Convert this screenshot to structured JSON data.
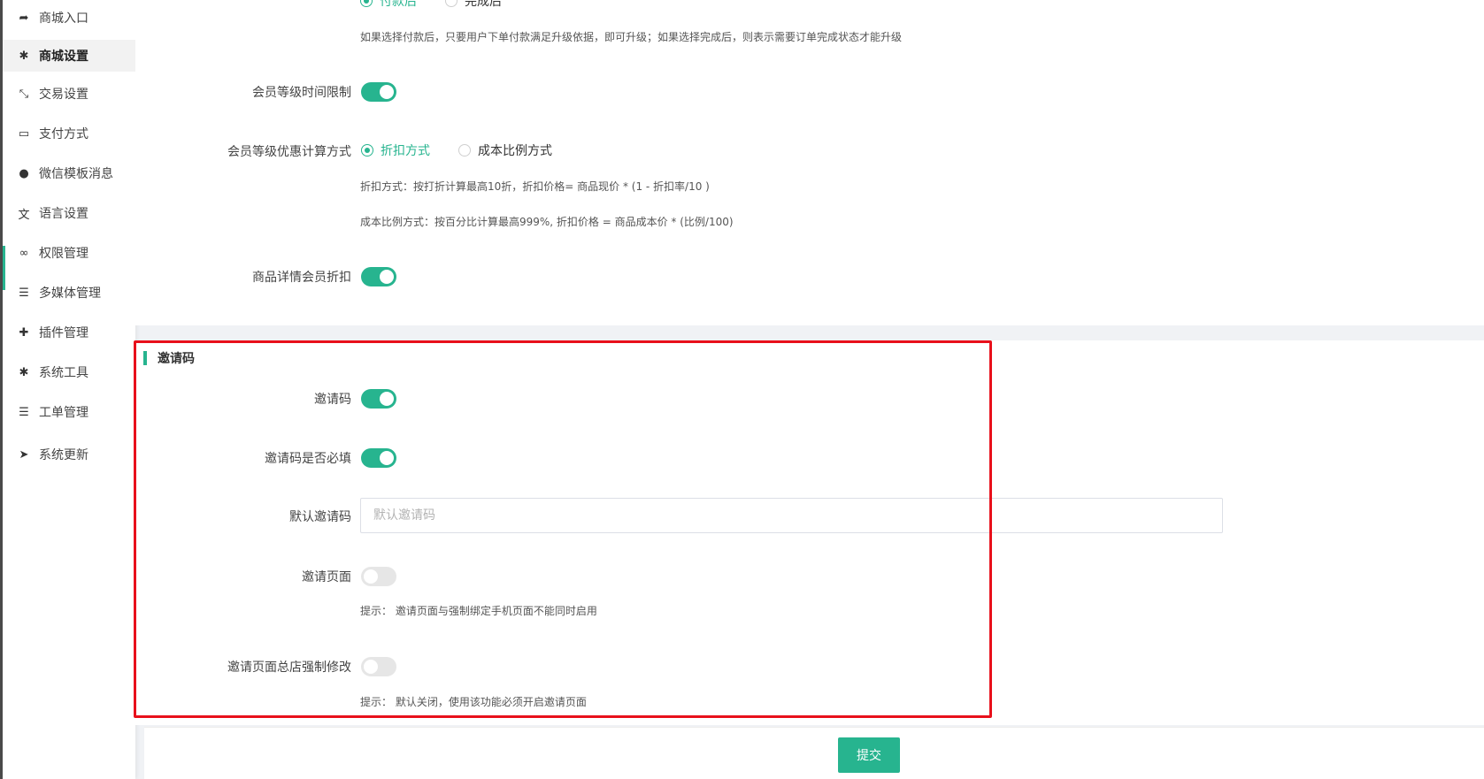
{
  "sidebar": {
    "items": [
      {
        "label": "商城入口",
        "icon": "share-icon",
        "glyph": "➦"
      },
      {
        "label": "商城设置",
        "icon": "gear-icon",
        "glyph": "✱",
        "active": true
      },
      {
        "label": "交易设置",
        "icon": "compress-arrows-icon",
        "glyph": "⤡"
      },
      {
        "label": "支付方式",
        "icon": "credit-card-icon",
        "glyph": "▭"
      },
      {
        "label": "微信模板消息",
        "icon": "wechat-icon",
        "glyph": "●"
      },
      {
        "label": "语言设置",
        "icon": "translate-icon",
        "glyph": "文"
      },
      {
        "label": "权限管理",
        "icon": "gamepad-icon",
        "glyph": "∞"
      },
      {
        "label": "多媒体管理",
        "icon": "list-icon",
        "glyph": "☰"
      },
      {
        "label": "插件管理",
        "icon": "puzzle-icon",
        "glyph": "✚"
      },
      {
        "label": "系统工具",
        "icon": "gear-icon",
        "glyph": "✱"
      },
      {
        "label": "工单管理",
        "icon": "list-icon",
        "glyph": "☰"
      },
      {
        "label": "系统更新",
        "icon": "paper-plane-icon",
        "glyph": "➤"
      }
    ]
  },
  "upgrade_timing": {
    "options": [
      "付款后",
      "完成后"
    ],
    "hint": "如果选择付款后，只要用户下单付款满足升级依据，即可升级；如果选择完成后，则表示需要订单完成状态才能升级"
  },
  "member_level_time_limit": {
    "label": "会员等级时间限制",
    "on": true
  },
  "discount_calc": {
    "label": "会员等级优惠计算方式",
    "options": [
      "折扣方式",
      "成本比例方式"
    ],
    "selected": "折扣方式",
    "hint1": "折扣方式：按打折计算最高10折，折扣价格= 商品现价 * (1 - 折扣率/10 )",
    "hint2": "成本比例方式：按百分比计算最高999%, 折扣价格 = 商品成本价 * (比例/100)"
  },
  "product_detail_discount": {
    "label": "商品详情会员折扣",
    "on": true
  },
  "invite_section": {
    "title": "邀请码",
    "invite_code": {
      "label": "邀请码",
      "on": true
    },
    "invite_required": {
      "label": "邀请码是否必填",
      "on": true
    },
    "default_code": {
      "label": "默认邀请码",
      "value": "",
      "placeholder": "默认邀请码"
    },
    "invite_page": {
      "label": "邀请页面",
      "on": false,
      "hint": "提示：  邀请页面与强制绑定手机页面不能同时启用"
    },
    "invite_page_force": {
      "label": "邀请页面总店强制修改",
      "on": false,
      "hint": "提示：  默认关闭，使用该功能必须开启邀请页面"
    }
  },
  "footer": {
    "submit_label": "提交"
  },
  "colors": {
    "accent": "#27b48f",
    "highlight_box": "#e8101b"
  }
}
